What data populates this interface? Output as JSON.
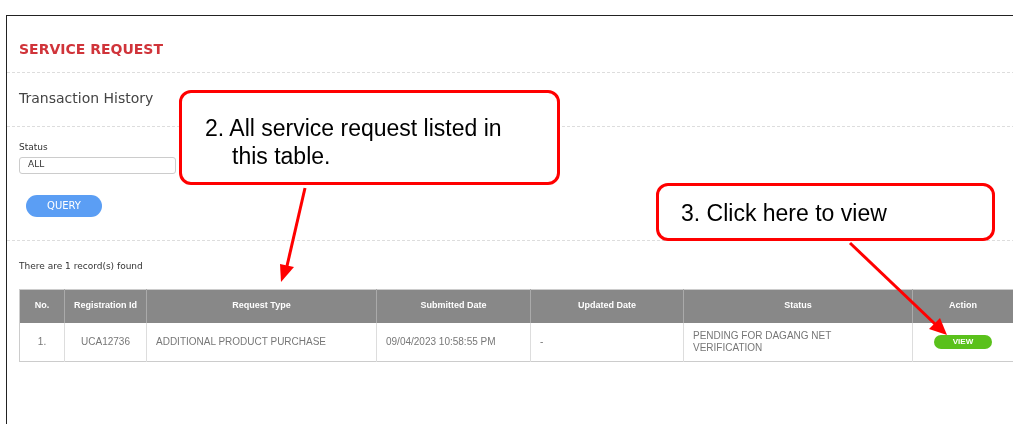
{
  "page_title": "SERVICE REQUEST",
  "section_title": "Transaction History",
  "status_filter": {
    "label": "Status",
    "value": "ALL"
  },
  "query_button": "QUERY",
  "record_count": "There are 1 record(s) found",
  "table": {
    "columns": [
      "No.",
      "Registration Id",
      "Request Type",
      "Submitted Date",
      "Updated Date",
      "Status",
      "Action"
    ],
    "rows": [
      {
        "cells": [
          "1.",
          "UCA12736",
          "ADDITIONAL PRODUCT PURCHASE",
          "09/04/2023 10:58:55 PM",
          "-",
          "PENDING FOR DAGANG NET VERIFICATION"
        ],
        "action": "VIEW"
      }
    ]
  },
  "callouts": [
    {
      "text": "2.  All service request listed in this table."
    },
    {
      "text": "3.  Click here to view"
    }
  ]
}
